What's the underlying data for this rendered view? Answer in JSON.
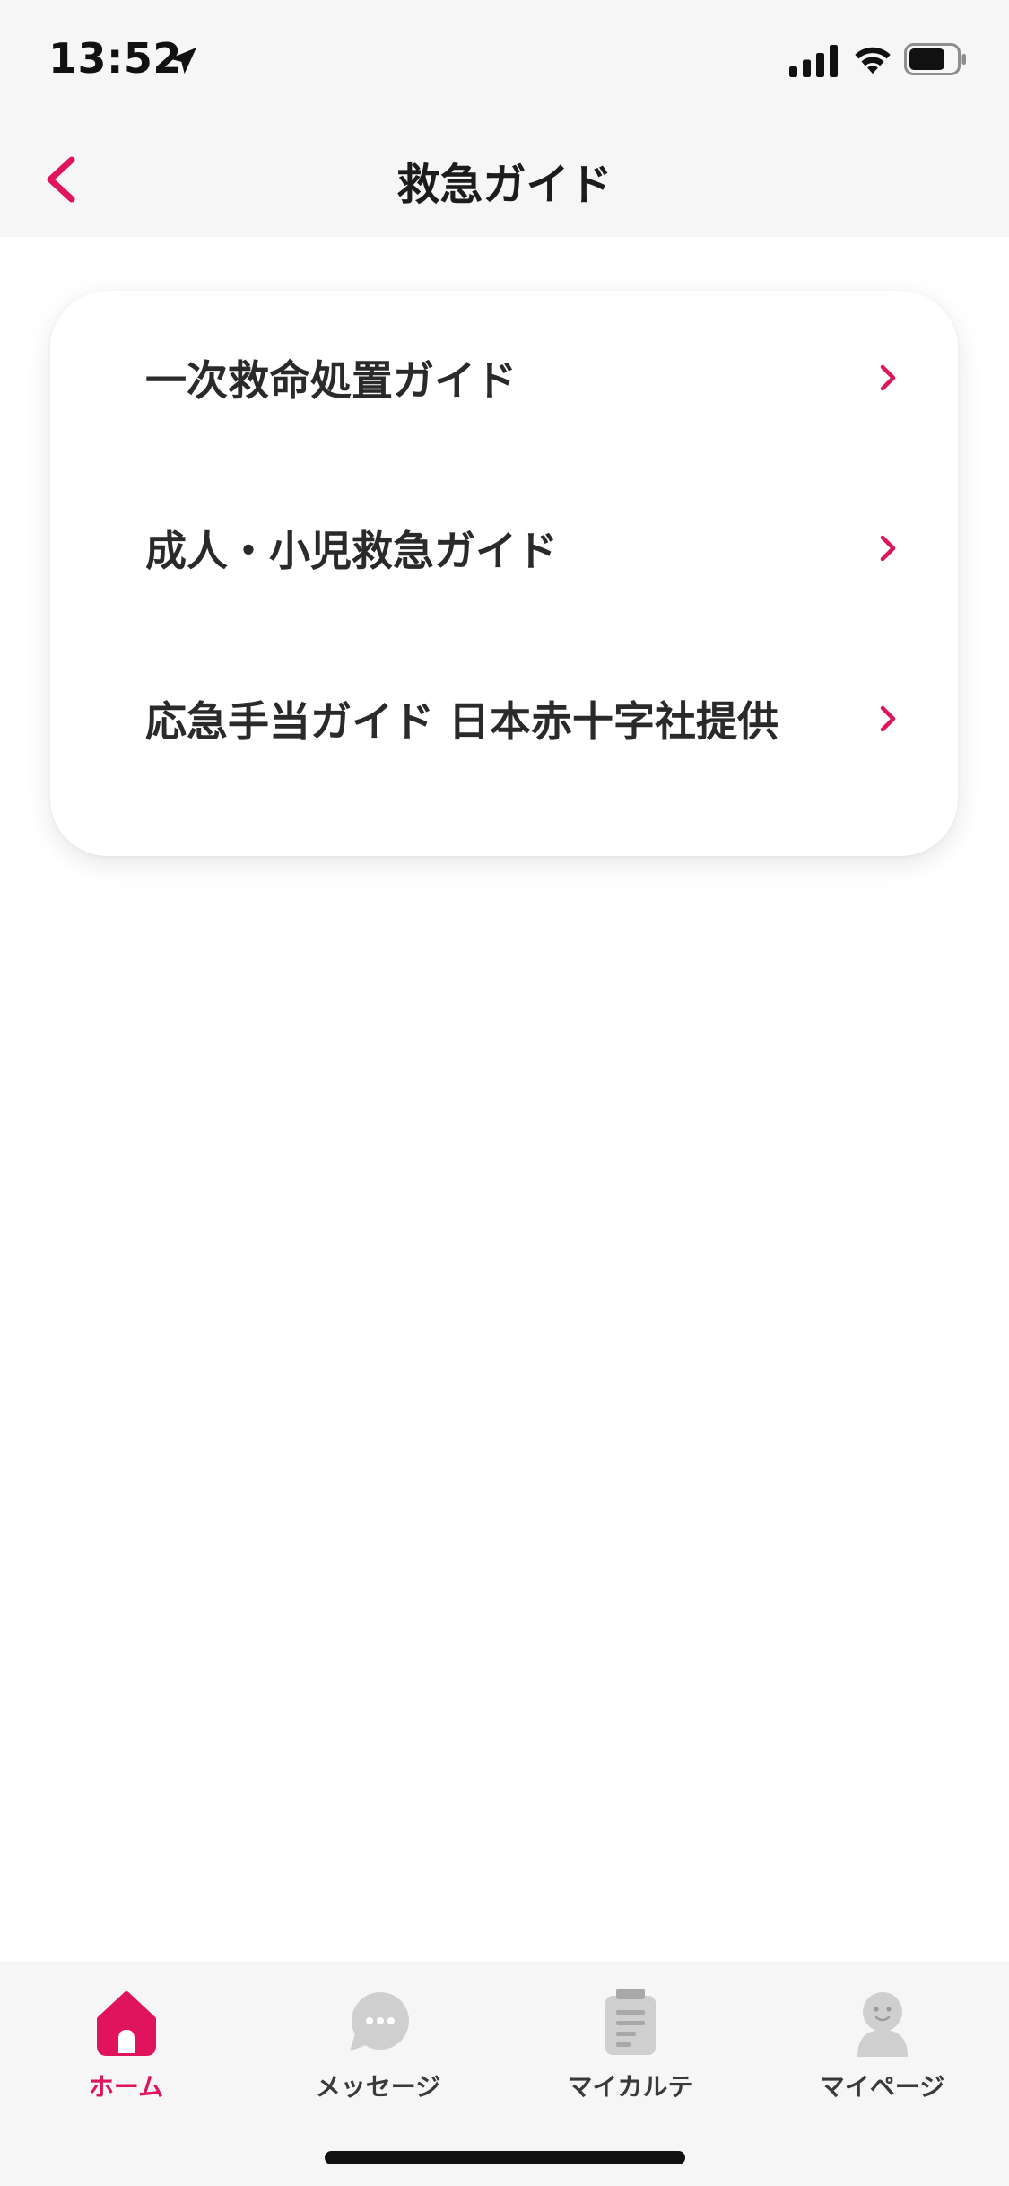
{
  "status_bar": {
    "time": "13:52",
    "icons": [
      "location-arrow-icon",
      "cellular-signal-icon",
      "wifi-icon",
      "battery-icon"
    ]
  },
  "nav": {
    "title": "救急ガイド",
    "back_icon": "chevron-left-icon"
  },
  "menu": {
    "items": [
      {
        "label": "一次救命処置ガイド",
        "icon": "chevron-right-icon"
      },
      {
        "label": "成人・小児救急ガイド",
        "icon": "chevron-right-icon"
      },
      {
        "label": "応急手当ガイド 日本赤十字社提供",
        "icon": "chevron-right-icon"
      }
    ]
  },
  "tabbar": {
    "tabs": [
      {
        "label": "ホーム",
        "icon": "home-icon",
        "active": true
      },
      {
        "label": "メッセージ",
        "icon": "chat-bubble-icon",
        "active": false
      },
      {
        "label": "マイカルテ",
        "icon": "clipboard-icon",
        "active": false
      },
      {
        "label": "マイページ",
        "icon": "person-icon",
        "active": false
      }
    ]
  },
  "colors": {
    "accent": "#e0145c",
    "bar_background": "#f6f6f6",
    "inactive_icon": "#cfcfcf",
    "text": "#222222"
  }
}
